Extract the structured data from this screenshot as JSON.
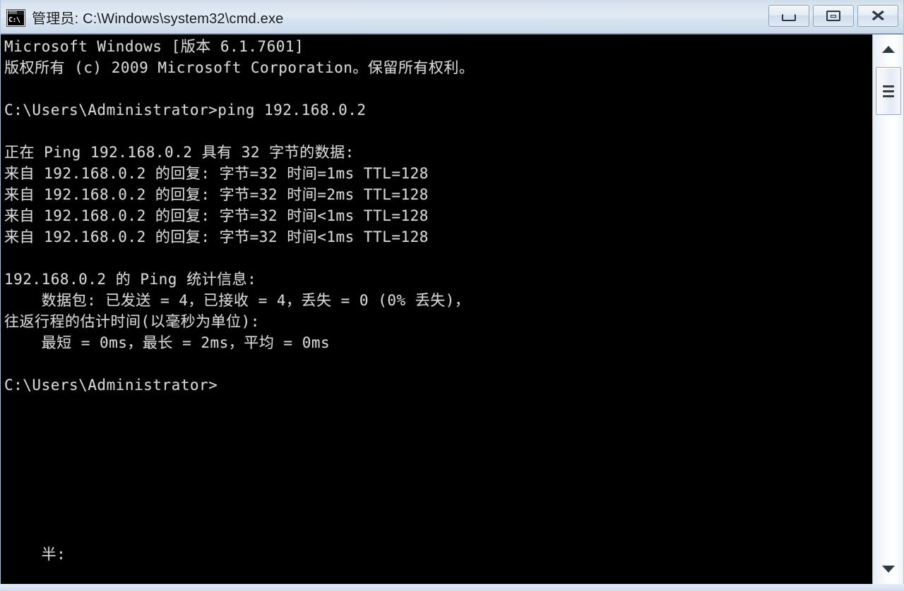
{
  "window": {
    "title": "管理员: C:\\Windows\\system32\\cmd.exe",
    "icon_name": "cmd-icon",
    "icon_text": "C:\\",
    "colors": {
      "titlebar_top": "#cfdcea",
      "titlebar_bottom": "#c6d6e8",
      "console_bg": "#000000",
      "console_fg": "#d6d6d6",
      "frame_border": "#93a7bb"
    },
    "buttons": {
      "minimize_label": "最小化",
      "maximize_label": "还原",
      "close_label": "关闭"
    }
  },
  "console": {
    "lines": [
      "Microsoft Windows [版本 6.1.7601]",
      "版权所有 (c) 2009 Microsoft Corporation。保留所有权利。",
      "",
      "C:\\Users\\Administrator>ping 192.168.0.2",
      "",
      "正在 Ping 192.168.0.2 具有 32 字节的数据:",
      "来自 192.168.0.2 的回复: 字节=32 时间=1ms TTL=128",
      "来自 192.168.0.2 的回复: 字节=32 时间=2ms TTL=128",
      "来自 192.168.0.2 的回复: 字节=32 时间<1ms TTL=128",
      "来自 192.168.0.2 的回复: 字节=32 时间<1ms TTL=128",
      "",
      "192.168.0.2 的 Ping 统计信息:",
      "    数据包: 已发送 = 4，已接收 = 4，丢失 = 0 (0% 丢失)，",
      "往返行程的估计时间(以毫秒为单位):",
      "    最短 = 0ms，最长 = 2ms，平均 = 0ms",
      "",
      "C:\\Users\\Administrator>",
      "",
      "",
      "",
      "",
      "",
      "",
      "",
      "    半:"
    ],
    "command": "ping 192.168.0.2",
    "prompt": "C:\\Users\\Administrator>",
    "target_host": "192.168.0.2",
    "packet_size_bytes": "32",
    "replies": [
      {
        "from": "192.168.0.2",
        "bytes": "32",
        "time": "=1ms",
        "ttl": "128"
      },
      {
        "from": "192.168.0.2",
        "bytes": "32",
        "time": "=2ms",
        "ttl": "128"
      },
      {
        "from": "192.168.0.2",
        "bytes": "32",
        "time": "<1ms",
        "ttl": "128"
      },
      {
        "from": "192.168.0.2",
        "bytes": "32",
        "time": "<1ms",
        "ttl": "128"
      }
    ],
    "statistics": {
      "sent": "4",
      "received": "4",
      "lost": "0",
      "loss_percent": "0%",
      "min_ms": "0ms",
      "max_ms": "2ms",
      "avg_ms": "0ms"
    }
  },
  "scrollbar": {
    "up_arrow": "scroll-up-arrow",
    "down_arrow": "scroll-down-arrow",
    "thumb": "scroll-thumb"
  }
}
